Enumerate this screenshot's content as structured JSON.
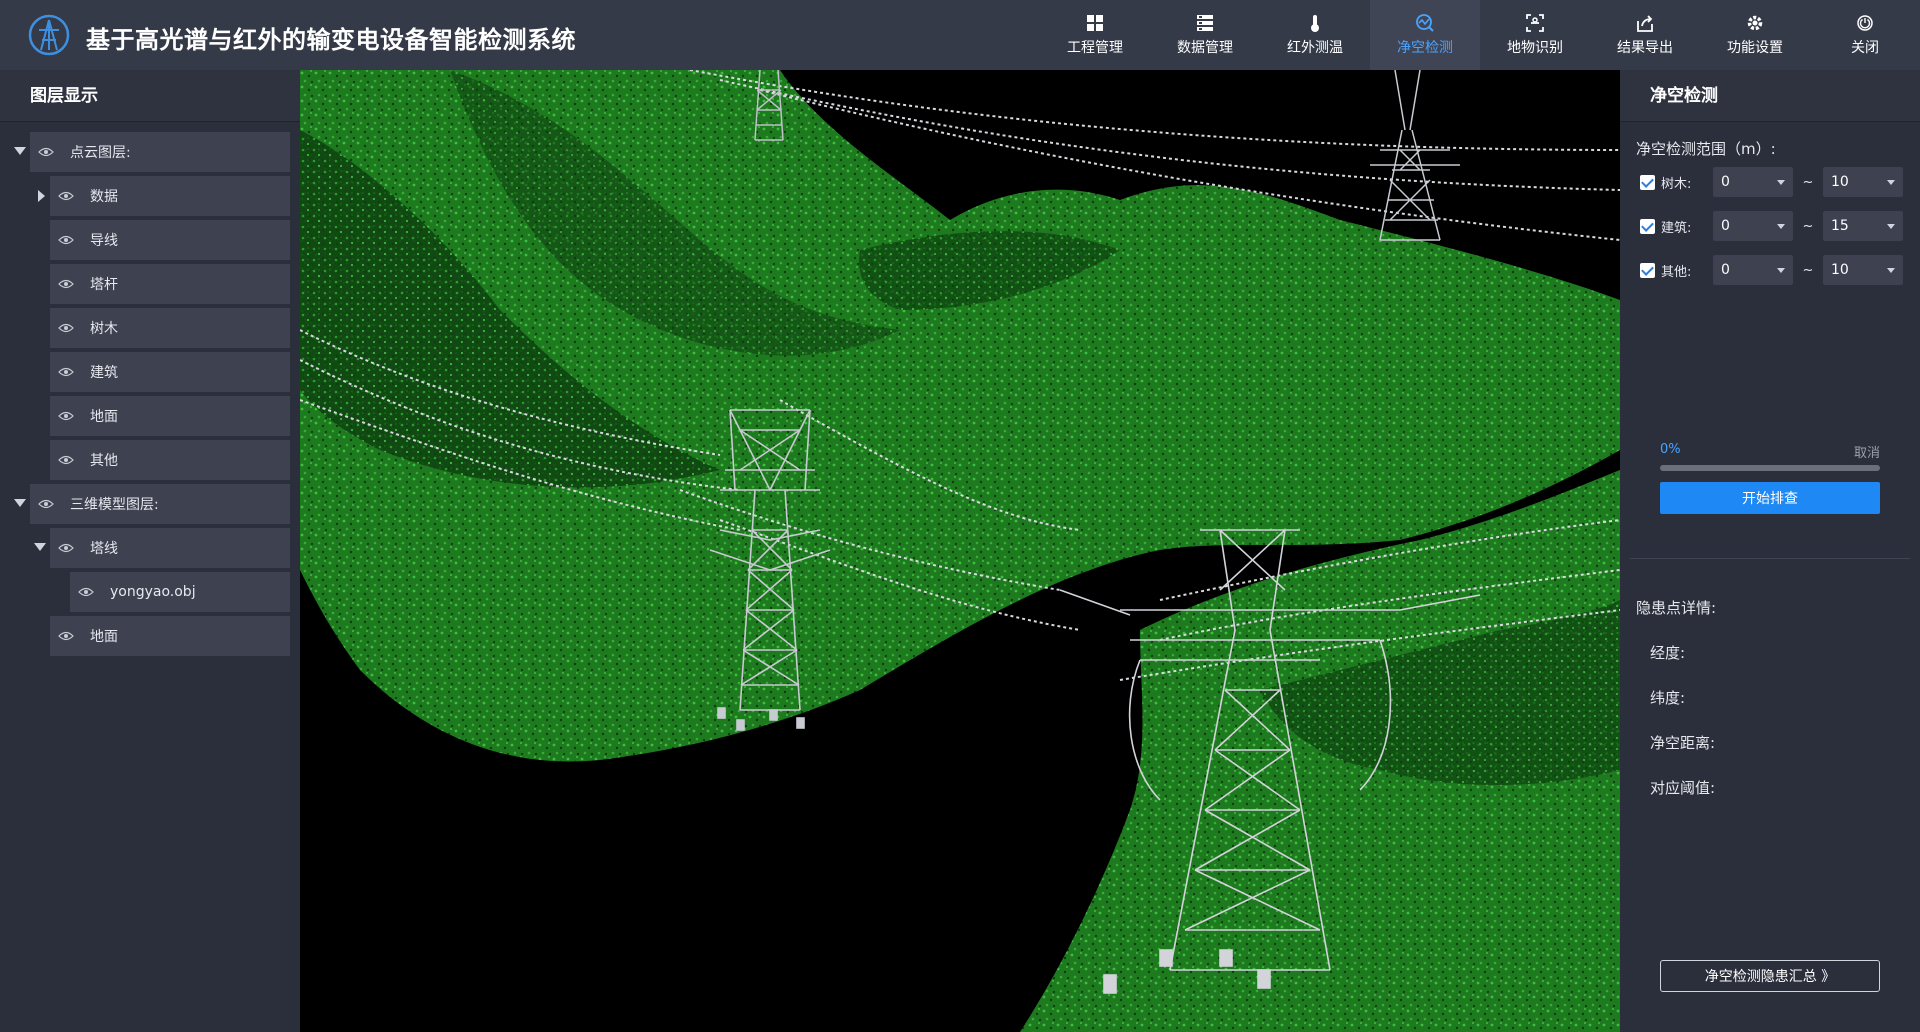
{
  "app": {
    "title": "基于高光谱与红外的输变电设备智能检测系统"
  },
  "nav": {
    "items": [
      {
        "label": "工程管理",
        "icon": "grid-icon"
      },
      {
        "label": "数据管理",
        "icon": "database-icon"
      },
      {
        "label": "红外测温",
        "icon": "thermometer-icon"
      },
      {
        "label": "净空检测",
        "icon": "clearance-icon",
        "active": true
      },
      {
        "label": "地物识别",
        "icon": "scan-icon"
      },
      {
        "label": "结果导出",
        "icon": "export-icon"
      },
      {
        "label": "功能设置",
        "icon": "gear-icon"
      },
      {
        "label": "关闭",
        "icon": "power-icon"
      }
    ]
  },
  "left_panel": {
    "title": "图层显示",
    "pointcloud_group": "点云图层:",
    "pointcloud_items": [
      "数据",
      "导线",
      "塔杆",
      "树木",
      "建筑",
      "地面",
      "其他"
    ],
    "model_group": "三维模型图层:",
    "tower_line": "塔线",
    "model_file": "yongyao.obj",
    "ground": "地面"
  },
  "right_panel": {
    "title": "净空检测",
    "range_label": "净空检测范围（m）:",
    "ranges": [
      {
        "label": "树木:",
        "min": "0",
        "max": "10",
        "checked": true
      },
      {
        "label": "建筑:",
        "min": "0",
        "max": "15",
        "checked": true
      },
      {
        "label": "其他:",
        "min": "0",
        "max": "10",
        "checked": true
      }
    ],
    "tilde": "~",
    "progress_text": "0%",
    "progress_value": 0,
    "cancel": "取消",
    "start_button": "开始排查",
    "details_title": "隐患点详情:",
    "details": {
      "longitude": "经度:",
      "latitude": "纬度:",
      "clearance": "净空距离:",
      "threshold": "对应阈值:"
    },
    "summary_button": "净空检测隐患汇总 》"
  },
  "colors": {
    "accent": "#1e88f5",
    "active_nav": "#4aa3ff",
    "vegetation": "#2e9a2e",
    "tower": "#c8cbd2"
  }
}
